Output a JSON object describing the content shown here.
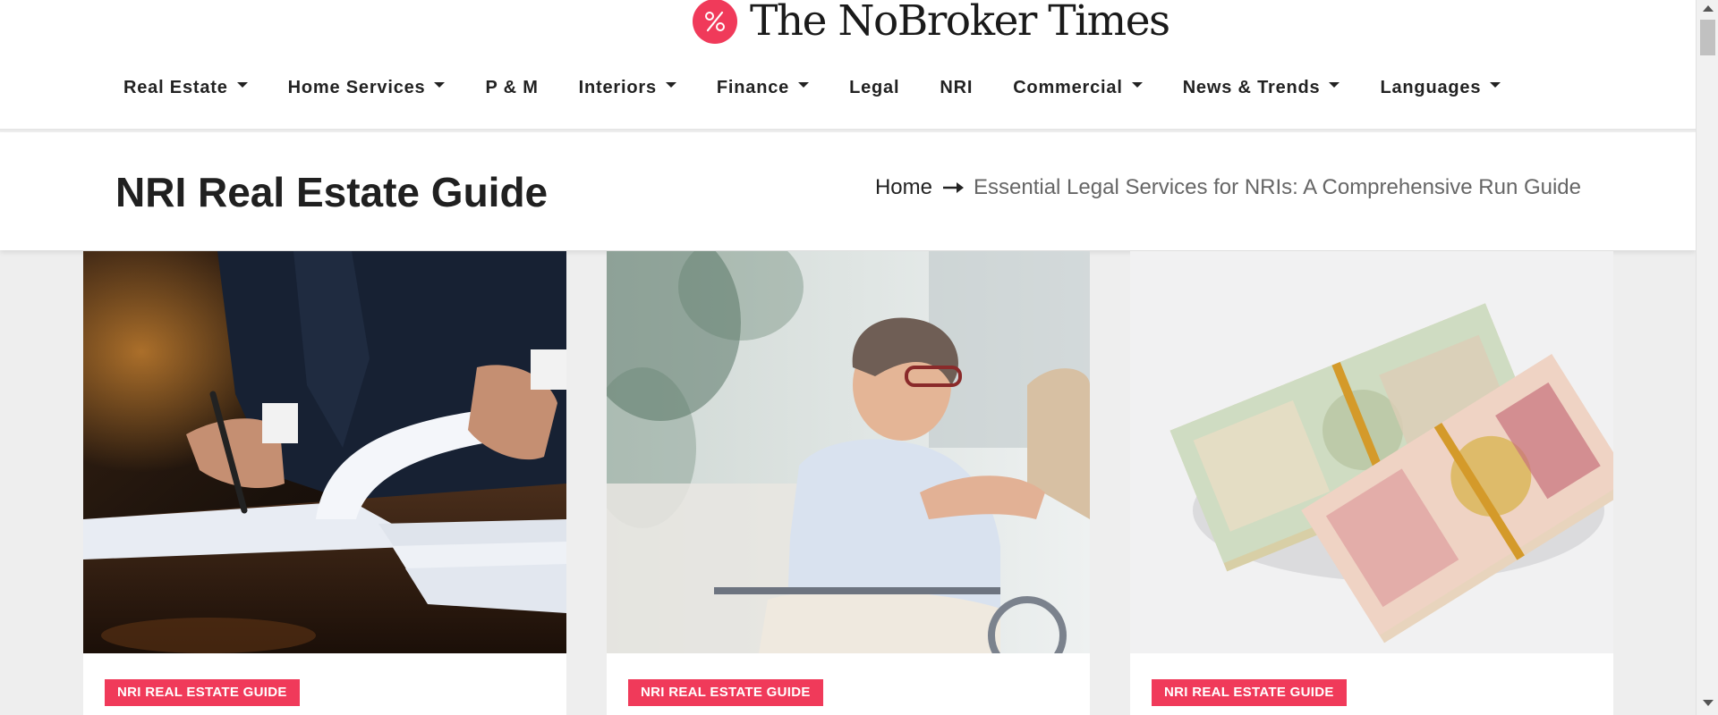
{
  "brand": {
    "name": "The NoBroker Times",
    "accent_color": "#f03a5a",
    "logo_icon": "percent-logo-icon"
  },
  "nav": {
    "items": [
      {
        "label": "Real Estate",
        "has_dropdown": true
      },
      {
        "label": "Home Services",
        "has_dropdown": true
      },
      {
        "label": "P & M",
        "has_dropdown": false
      },
      {
        "label": "Interiors",
        "has_dropdown": true
      },
      {
        "label": "Finance",
        "has_dropdown": true
      },
      {
        "label": "Legal",
        "has_dropdown": false
      },
      {
        "label": "NRI",
        "has_dropdown": false
      },
      {
        "label": "Commercial",
        "has_dropdown": true
      },
      {
        "label": "News & Trends",
        "has_dropdown": true
      },
      {
        "label": "Languages",
        "has_dropdown": true
      }
    ]
  },
  "page": {
    "title": "NRI Real Estate Guide"
  },
  "breadcrumb": {
    "home": "Home",
    "current": "Essential Legal Services for NRIs: A Comprehensive Run Guide",
    "separator_icon": "long-arrow-right-icon"
  },
  "cards": [
    {
      "category": "NRI REAL ESTATE GUIDE",
      "image": "document-signing-photo"
    },
    {
      "category": "NRI REAL ESTATE GUIDE",
      "image": "elderly-care-photo"
    },
    {
      "category": "NRI REAL ESTATE GUIDE",
      "image": "currency-notes-photo"
    }
  ]
}
